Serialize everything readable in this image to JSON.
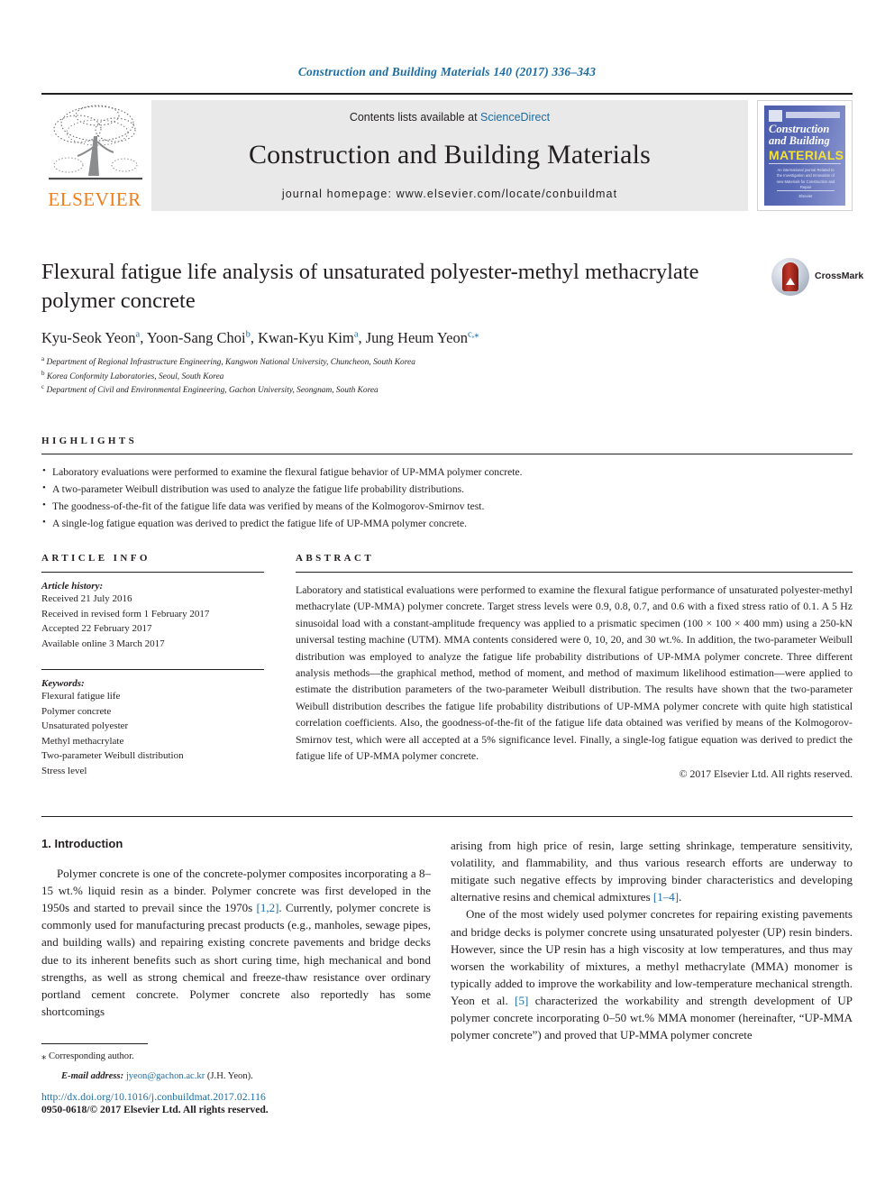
{
  "running_head": "Construction and Building Materials 140 (2017) 336–343",
  "masthead": {
    "publisher_name": "ELSEVIER",
    "contents_prefix": "Contents lists available at ",
    "contents_link": "ScienceDirect",
    "journal_title": "Construction and Building Materials",
    "homepage_label": "journal homepage: www.elsevier.com/locate/conbuildmat",
    "cover": {
      "line1": "Construction",
      "line2": "and Building",
      "line3": "MATERIALS",
      "subtitle": "An international journal Related to the Investigation and Innovation of new Materials for Construction and Repair",
      "footer": "Elsevier"
    }
  },
  "article": {
    "title": "Flexural fatigue life analysis of unsaturated polyester-methyl methacrylate polymer concrete",
    "authors": [
      {
        "name": "Kyu-Seok Yeon",
        "marks": "a"
      },
      {
        "name": "Yoon-Sang Choi",
        "marks": "b"
      },
      {
        "name": "Kwan-Kyu Kim",
        "marks": "a"
      },
      {
        "name": "Jung Heum Yeon",
        "marks": "c,⁎"
      }
    ],
    "affiliations": [
      {
        "mark": "a",
        "text": "Department of Regional Infrastructure Engineering, Kangwon National University, Chuncheon, South Korea"
      },
      {
        "mark": "b",
        "text": "Korea Conformity Laboratories, Seoul, South Korea"
      },
      {
        "mark": "c",
        "text": "Department of Civil and Environmental Engineering, Gachon University, Seongnam, South Korea"
      }
    ],
    "crossmark_label": "CrossMark"
  },
  "highlights": {
    "heading": "HIGHLIGHTS",
    "items": [
      "Laboratory evaluations were performed to examine the flexural fatigue behavior of UP-MMA polymer concrete.",
      "A two-parameter Weibull distribution was used to analyze the fatigue life probability distributions.",
      "The goodness-of-the-fit of the fatigue life data was verified by means of the Kolmogorov-Smirnov test.",
      "A single-log fatigue equation was derived to predict the fatigue life of UP-MMA polymer concrete."
    ]
  },
  "article_info": {
    "heading": "ARTICLE INFO",
    "history_label": "Article history:",
    "history": [
      "Received 21 July 2016",
      "Received in revised form 1 February 2017",
      "Accepted 22 February 2017",
      "Available online 3 March 2017"
    ],
    "keywords_label": "Keywords:",
    "keywords": [
      "Flexural fatigue life",
      "Polymer concrete",
      "Unsaturated polyester",
      "Methyl methacrylate",
      "Two-parameter Weibull distribution",
      "Stress level"
    ]
  },
  "abstract": {
    "heading": "ABSTRACT",
    "text": "Laboratory and statistical evaluations were performed to examine the flexural fatigue performance of unsaturated polyester-methyl methacrylate (UP-MMA) polymer concrete. Target stress levels were 0.9, 0.8, 0.7, and 0.6 with a fixed stress ratio of 0.1. A 5 Hz sinusoidal load with a constant-amplitude frequency was applied to a prismatic specimen (100 × 100 × 400 mm) using a 250-kN universal testing machine (UTM). MMA contents considered were 0, 10, 20, and 30 wt.%. In addition, the two-parameter Weibull distribution was employed to analyze the fatigue life probability distributions of UP-MMA polymer concrete. Three different analysis methods—the graphical method, method of moment, and method of maximum likelihood estimation—were applied to estimate the distribution parameters of the two-parameter Weibull distribution. The results have shown that the two-parameter Weibull distribution describes the fatigue life probability distributions of UP-MMA polymer concrete with quite high statistical correlation coefficients. Also, the goodness-of-the-fit of the fatigue life data obtained was verified by means of the Kolmogorov-Smirnov test, which were all accepted at a 5% significance level. Finally, a single-log fatigue equation was derived to predict the fatigue life of UP-MMA polymer concrete.",
    "copyright": "© 2017 Elsevier Ltd. All rights reserved."
  },
  "introduction": {
    "heading": "1. Introduction",
    "left_paragraphs": [
      "Polymer concrete is one of the concrete-polymer composites incorporating a 8–15 wt.% liquid resin as a binder. Polymer concrete was first developed in the 1950s and started to prevail since the 1970s [1,2]. Currently, polymer concrete is commonly used for manufacturing precast products (e.g., manholes, sewage pipes, and building walls) and repairing existing concrete pavements and bridge decks due to its inherent benefits such as short curing time, high mechanical and bond strengths, as well as strong chemical and freeze-thaw resistance over ordinary portland cement concrete. Polymer concrete also reportedly has some shortcomings"
    ],
    "right_paragraphs": [
      "arising from high price of resin, large setting shrinkage, temperature sensitivity, volatility, and flammability, and thus various research efforts are underway to mitigate such negative effects by improving binder characteristics and developing alternative resins and chemical admixtures [1–4].",
      "One of the most widely used polymer concretes for repairing existing pavements and bridge decks is polymer concrete using unsaturated polyester (UP) resin binders. However, since the UP resin has a high viscosity at low temperatures, and thus may worsen the workability of mixtures, a methyl methacrylate (MMA) monomer is typically added to improve the workability and low-temperature mechanical strength. Yeon et al. [5] characterized the workability and strength development of UP polymer concrete incorporating 0–50 wt.% MMA monomer (hereinafter, “UP-MMA polymer concrete”) and proved that UP-MMA polymer concrete"
    ]
  },
  "footnote": {
    "corresponding_mark": "⁎",
    "corresponding_text": "Corresponding author.",
    "email_label": "E-mail address:",
    "email": "jyeon@gachon.ac.kr",
    "email_suffix": "(J.H. Yeon)."
  },
  "page_footer": {
    "doi": "http://dx.doi.org/10.1016/j.conbuildmat.2017.02.116",
    "issn_line": "0950-0618/© 2017 Elsevier Ltd. All rights reserved."
  },
  "colors": {
    "link": "#1b6ca3",
    "elsevier_orange": "#ef7d1a",
    "text": "#231f20",
    "band": "#e9e9e9",
    "cover_blue": "#4458a6"
  }
}
